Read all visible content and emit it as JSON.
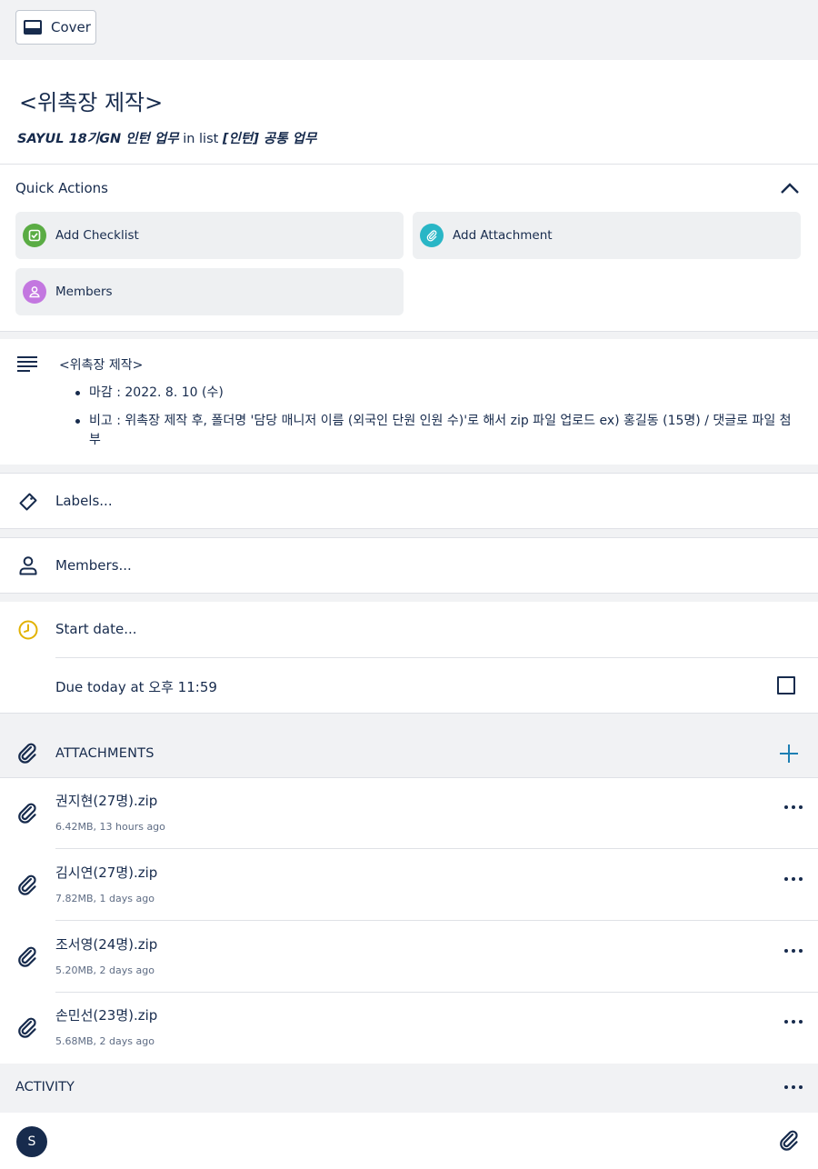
{
  "toolbar": {
    "cover_label": "Cover"
  },
  "card": {
    "title": "<위촉장 제작>",
    "board": "SAYUL 18기GN 인턴 업무",
    "in_list": "in list",
    "list": "[인턴] 공통 업무"
  },
  "quick_actions": {
    "title": "Quick Actions",
    "items": [
      {
        "label": "Add Checklist",
        "color": "#5aac44"
      },
      {
        "label": "Add Attachment",
        "color": "#29b6c6"
      },
      {
        "label": "Members",
        "color": "#c377e0"
      }
    ]
  },
  "description": {
    "heading": "<위촉장 제작>",
    "bullets": [
      "마감 : 2022. 8. 10 (수)",
      "비고 : 위촉장 제작 후, 폴더명 '담당 매니저 이름 (외국인 단원 인원 수)'로 해서 zip 파일 업로드 ex) 홍길동 (15명) / 댓글로 파일 첨부"
    ]
  },
  "fields": {
    "labels": "Labels...",
    "members": "Members...",
    "start_date": "Start date...",
    "due": "Due today at 오후 11:59"
  },
  "attachments": {
    "title": "ATTACHMENTS",
    "items": [
      {
        "name": "권지현(27명).zip",
        "meta": "6.42MB, 13 hours ago"
      },
      {
        "name": "김시연(27명).zip",
        "meta": "7.82MB, 1 days ago"
      },
      {
        "name": "조서영(24명).zip",
        "meta": "5.20MB, 2 days ago"
      },
      {
        "name": "손민선(23명).zip",
        "meta": "5.68MB, 2 days ago"
      }
    ]
  },
  "activity": {
    "title": "ACTIVITY",
    "avatar_initial": "S"
  },
  "colors": {
    "text": "#172b4d",
    "accent": "#1d7fb3",
    "clock": "#e2b203",
    "gray_bg": "#f1f2f4"
  }
}
